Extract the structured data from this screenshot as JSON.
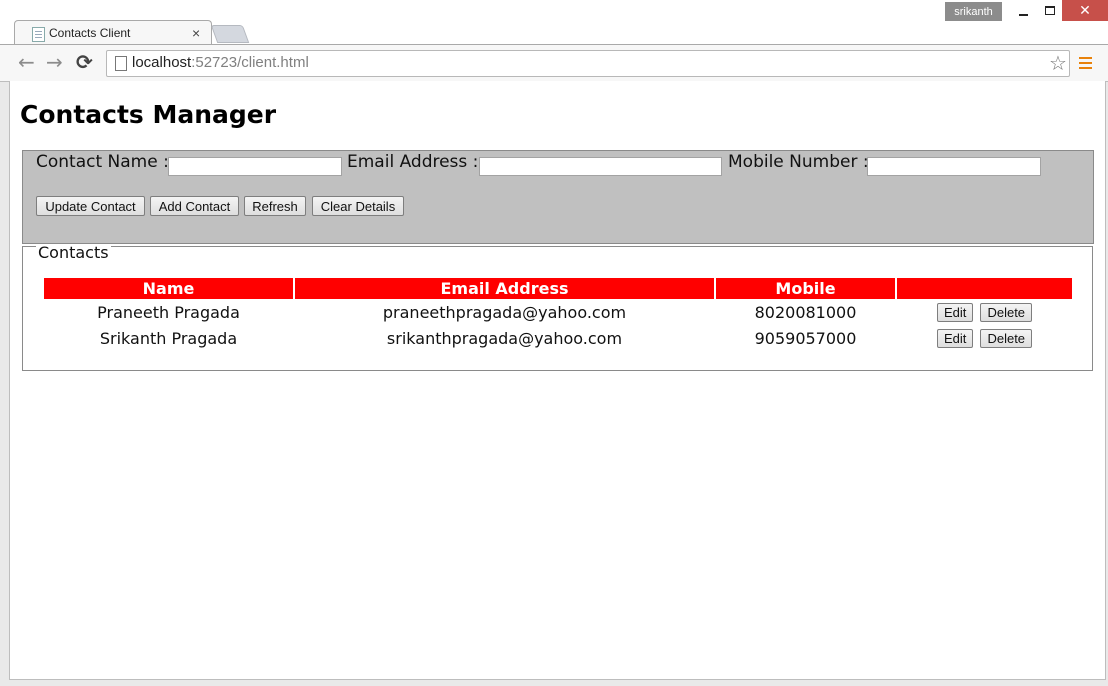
{
  "browser": {
    "user_badge": "srikanth",
    "tab_title": "Contacts Client",
    "tab_close": "×",
    "url_host": "localhost",
    "url_rest": ":52723/client.html",
    "icons": {
      "back": "back-arrow-icon",
      "forward": "forward-arrow-icon",
      "reload": "reload-icon",
      "bookmark": "star-icon",
      "menu": "hamburger-menu-icon",
      "close": "window-close-icon"
    },
    "glyphs": {
      "back": "←",
      "forward": "→",
      "reload": "⟳",
      "star": "☆",
      "close": "✕"
    },
    "accent_colors": {
      "close_button": "#c7504a",
      "menu_icon": "#e8820c"
    }
  },
  "page": {
    "title": "Contacts Manager"
  },
  "form": {
    "name_label": "Contact Name :",
    "email_label": "Email Address :",
    "mobile_label": "Mobile Number :",
    "name_value": "",
    "email_value": "",
    "mobile_value": "",
    "buttons": {
      "update": "Update Contact",
      "add": "Add Contact",
      "refresh": "Refresh",
      "clear": "Clear Details"
    },
    "panel_color": "#c0c0c0"
  },
  "contacts": {
    "legend": "Contacts",
    "header_color": "#ff0000",
    "columns": [
      "Name",
      "Email Address",
      "Mobile",
      ""
    ],
    "rows": [
      {
        "name": "Praneeth Pragada",
        "email": "praneethpragada@yahoo.com",
        "mobile": "8020081000",
        "edit": "Edit",
        "delete": "Delete"
      },
      {
        "name": "Srikanth Pragada",
        "email": "srikanthpragada@yahoo.com",
        "mobile": "9059057000",
        "edit": "Edit",
        "delete": "Delete"
      }
    ]
  }
}
